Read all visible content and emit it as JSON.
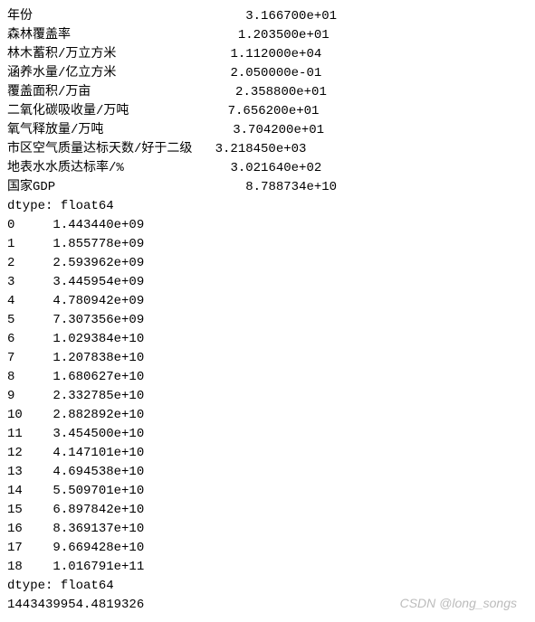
{
  "summary_rows": [
    {
      "label": "年份",
      "value": "3.166700e+01"
    },
    {
      "label": "森林覆盖率",
      "value": "1.203500e+01"
    },
    {
      "label": "林木蓄积/万立方米",
      "value": "1.112000e+04"
    },
    {
      "label": "涵养水量/亿立方米",
      "value": "2.050000e-01"
    },
    {
      "label": "覆盖面积/万亩",
      "value": "2.358800e+01"
    },
    {
      "label": "二氧化碳吸收量/万吨",
      "value": "7.656200e+01"
    },
    {
      "label": "氧气释放量/万吨",
      "value": "3.704200e+01"
    },
    {
      "label": "市区空气质量达标天数/好于二级",
      "value": "3.218450e+03"
    },
    {
      "label": "地表水水质达标率/%",
      "value": "3.021640e+02"
    },
    {
      "label": "国家GDP",
      "value": "8.788734e+10"
    }
  ],
  "dtype1": "dtype: float64",
  "series_rows": [
    {
      "index": "0",
      "value": "1.443440e+09"
    },
    {
      "index": "1",
      "value": "1.855778e+09"
    },
    {
      "index": "2",
      "value": "2.593962e+09"
    },
    {
      "index": "3",
      "value": "3.445954e+09"
    },
    {
      "index": "4",
      "value": "4.780942e+09"
    },
    {
      "index": "5",
      "value": "7.307356e+09"
    },
    {
      "index": "6",
      "value": "1.029384e+10"
    },
    {
      "index": "7",
      "value": "1.207838e+10"
    },
    {
      "index": "8",
      "value": "1.680627e+10"
    },
    {
      "index": "9",
      "value": "2.332785e+10"
    },
    {
      "index": "10",
      "value": "2.882892e+10"
    },
    {
      "index": "11",
      "value": "3.454500e+10"
    },
    {
      "index": "12",
      "value": "4.147101e+10"
    },
    {
      "index": "13",
      "value": "4.694538e+10"
    },
    {
      "index": "14",
      "value": "5.509701e+10"
    },
    {
      "index": "15",
      "value": "6.897842e+10"
    },
    {
      "index": "16",
      "value": "8.369137e+10"
    },
    {
      "index": "17",
      "value": "9.669428e+10"
    },
    {
      "index": "18",
      "value": "1.016791e+11"
    }
  ],
  "dtype2": "dtype: float64",
  "final_value": "1443439954.4819326",
  "watermark": "CSDN @long_songs"
}
